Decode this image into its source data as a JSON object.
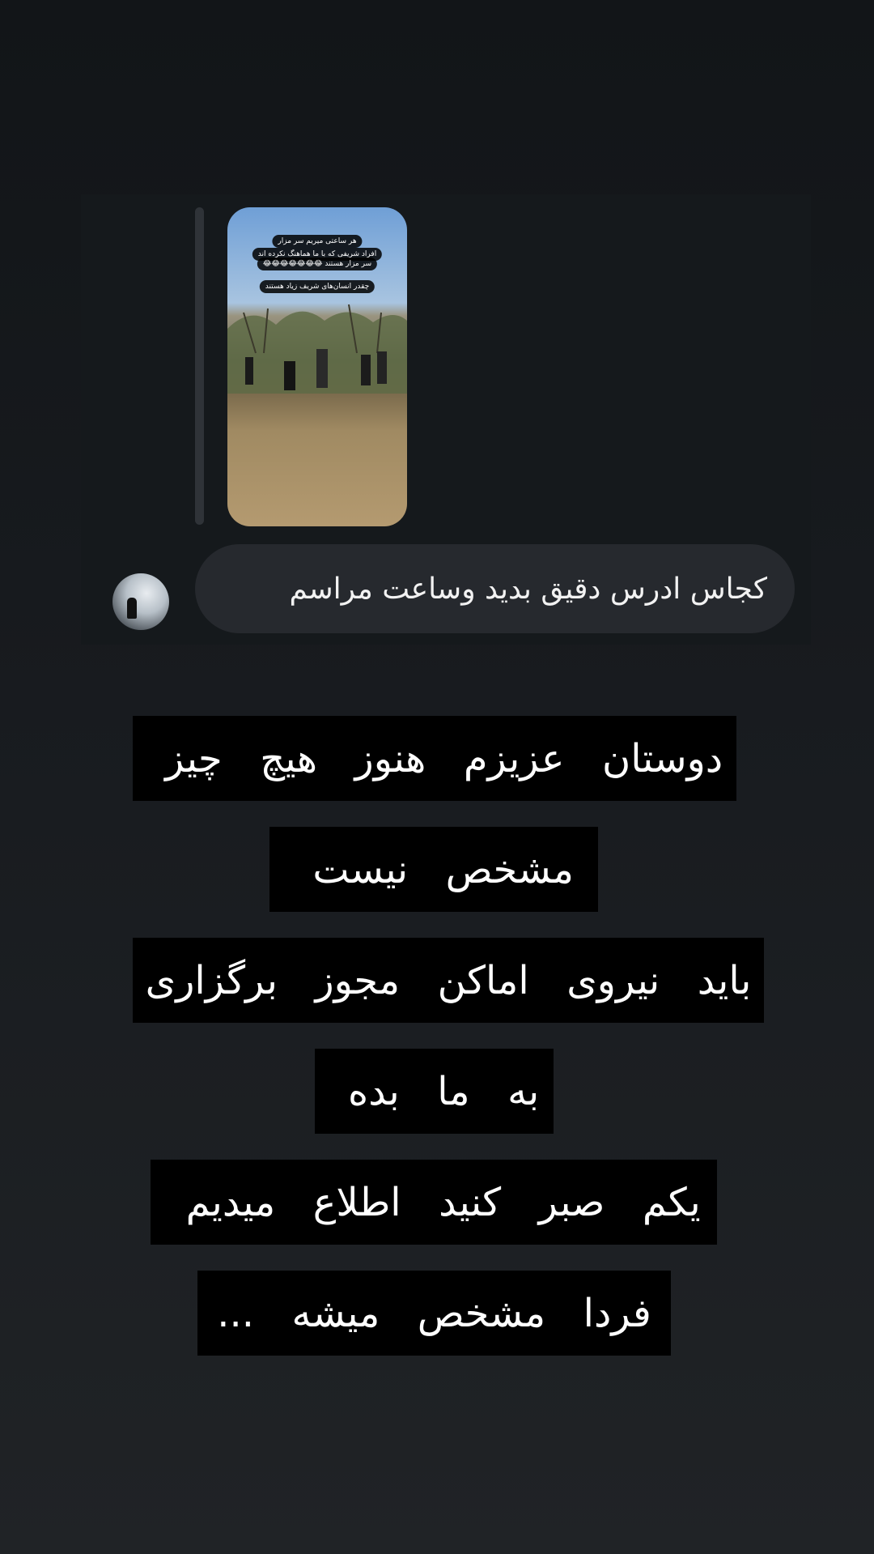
{
  "reply": {
    "story_captions": [
      "هر ساعتی میریم سر مزار",
      "افراد شریفی که با ما هماهنگ نکرده اند",
      "سر مزار هستند 😂😂😂😂😂😂😂",
      "چقدر انسان‌های شریف زیاد هستند"
    ],
    "message": "کجاس ادرس دقیق بدید وساعت مراسم"
  },
  "overlay_text": {
    "lines": [
      "دوستان  عزیزم  هنوز  هیچ  چیز ",
      "مشخص  نیست ",
      "باید  نیروی  اماکن  مجوز  برگزاری",
      "به  ما  بده ",
      "یکم  صبر  کنید  اطلاع  میدیم ",
      "فردا  مشخص  میشه  ..."
    ]
  },
  "colors": {
    "background_top": "#121518",
    "background_bottom": "#202326",
    "bubble": "#26292e",
    "text_highlight": "#000000"
  }
}
